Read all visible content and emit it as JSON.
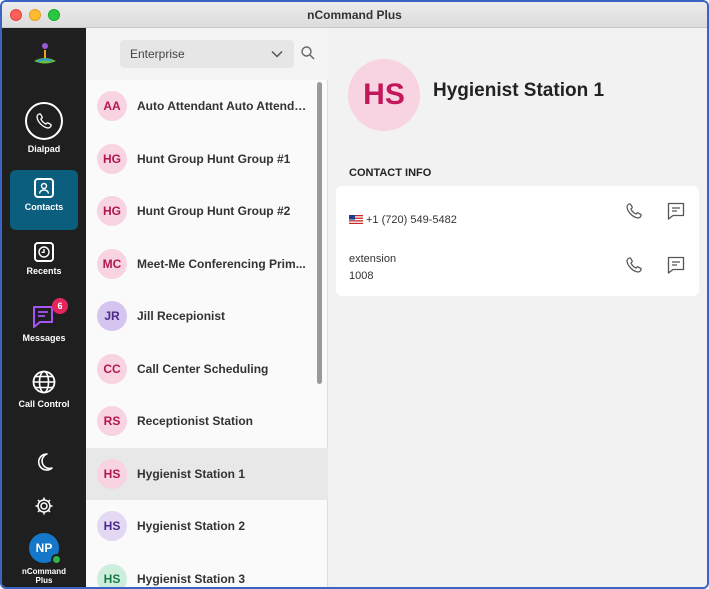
{
  "window": {
    "title": "nCommand Plus"
  },
  "colors": {
    "rail_bg": "#1f1f1f",
    "rail_active": "#0b5e7d",
    "badge": "#e2265b",
    "presence": "#2fb54a"
  },
  "rail": {
    "items": [
      {
        "label": "Dialpad",
        "icon": "phone-icon"
      },
      {
        "label": "Contacts",
        "icon": "person-icon",
        "active": true
      },
      {
        "label": "Recents",
        "icon": "clock-icon"
      },
      {
        "label": "Messages",
        "icon": "message-icon",
        "badge": "6"
      },
      {
        "label": "Call Control",
        "icon": "globe-icon"
      }
    ],
    "theme_icon": "moon-icon",
    "settings_icon": "gear-icon",
    "user": {
      "initials": "NP",
      "label_line1": "nCommand",
      "label_line2": "Plus"
    }
  },
  "list": {
    "directory": "Enterprise",
    "contacts": [
      {
        "initials": "AA",
        "name": "Auto Attendant Auto Attenda...",
        "bg": "#f8d3e1",
        "fg": "#b3174f"
      },
      {
        "initials": "HG",
        "name": "Hunt Group Hunt Group #1",
        "bg": "#f8d3e1",
        "fg": "#b3174f"
      },
      {
        "initials": "HG",
        "name": "Hunt Group Hunt Group #2",
        "bg": "#f8d3e1",
        "fg": "#b3174f"
      },
      {
        "initials": "MC",
        "name": "Meet-Me Conferencing Prim...",
        "bg": "#f8d3e1",
        "fg": "#b3174f"
      },
      {
        "initials": "JR",
        "name": "Jill Recepionist",
        "bg": "#d4c4ef",
        "fg": "#4a2a8a"
      },
      {
        "initials": "CC",
        "name": "Call Center Scheduling",
        "bg": "#f8d3e1",
        "fg": "#b3174f"
      },
      {
        "initials": "RS",
        "name": "Receptionist Station",
        "bg": "#f8d3e1",
        "fg": "#b3174f"
      },
      {
        "initials": "HS",
        "name": "Hygienist Station 1",
        "bg": "#f8d3e1",
        "fg": "#b3174f",
        "selected": true
      },
      {
        "initials": "HS",
        "name": "Hygienist Station 2",
        "bg": "#e3d9f3",
        "fg": "#4a2a8a"
      },
      {
        "initials": "HS",
        "name": "Hygienist Station 3",
        "bg": "#cdeedc",
        "fg": "#157a44"
      }
    ]
  },
  "detail": {
    "initials": "HS",
    "name": "Hygienist Station 1",
    "section_title": "CONTACT INFO",
    "entries": [
      {
        "label": "",
        "value": "+1 (720) 549-5482",
        "flag": "us-flag-icon"
      },
      {
        "label": "extension",
        "value": "1008"
      }
    ]
  }
}
